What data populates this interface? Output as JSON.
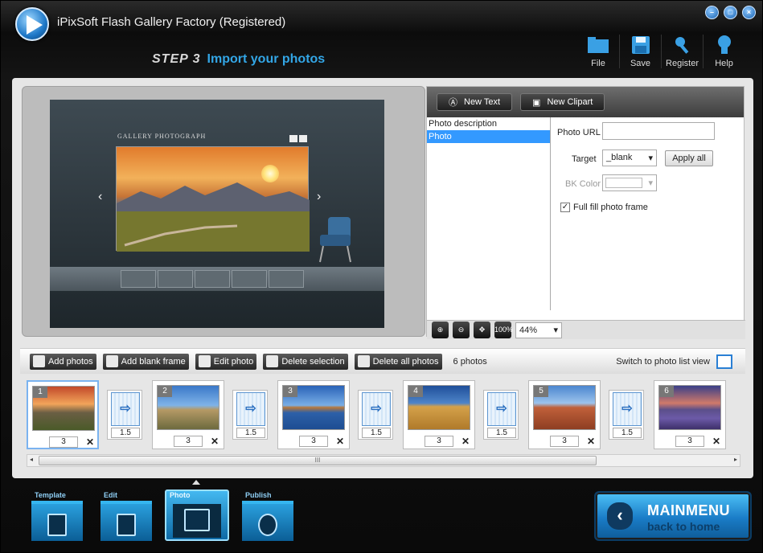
{
  "app": {
    "title": "iPixSoft Flash Gallery Factory (Registered)"
  },
  "window_controls": [
    "–",
    "□",
    "×"
  ],
  "step": {
    "number": "STEP 3",
    "text": "Import your photos"
  },
  "toolbar": [
    {
      "label": "File",
      "icon": "folder-icon"
    },
    {
      "label": "Save",
      "icon": "save-icon"
    },
    {
      "label": "Register",
      "icon": "key-icon"
    },
    {
      "label": "Help",
      "icon": "bulb-icon"
    }
  ],
  "preview": {
    "gallery_title": "GALLERY PHOTOGRAPH",
    "prev_arrow": "‹",
    "next_arrow": "›"
  },
  "side": {
    "new_text": "New Text",
    "new_clipart": "New Clipart",
    "list": [
      "Photo description",
      "Photo"
    ],
    "photo_url_label": "Photo URL",
    "photo_url_value": "",
    "target_label": "Target",
    "target_value": "_blank",
    "apply_all": "Apply all",
    "bk_color_label": "BK Color",
    "full_fill_label": "Full fill photo frame",
    "full_fill_checked": true,
    "zoom_value": "44%",
    "zoom_100": "100%"
  },
  "actions": {
    "add_photos": "Add photos",
    "add_blank_frame": "Add blank frame",
    "edit_photo": "Edit photo",
    "delete_selection": "Delete selection",
    "delete_all_photos": "Delete all photos",
    "count": "6 photos",
    "switch_view": "Switch to photo list view"
  },
  "photos": [
    {
      "num": "1",
      "duration": "3",
      "delete": "✕"
    },
    {
      "num": "2",
      "duration": "3",
      "delete": "✕"
    },
    {
      "num": "3",
      "duration": "3",
      "delete": "✕"
    },
    {
      "num": "4",
      "duration": "3",
      "delete": "✕"
    },
    {
      "num": "5",
      "duration": "3",
      "delete": "✕"
    },
    {
      "num": "6",
      "duration": "3",
      "delete": "✕"
    }
  ],
  "transitions": [
    {
      "duration": "1.5",
      "icon": "⇨"
    },
    {
      "duration": "1.5",
      "icon": "⇨"
    },
    {
      "duration": "1.5",
      "icon": "⇨"
    },
    {
      "duration": "1.5",
      "icon": "⇨"
    },
    {
      "duration": "1.5",
      "icon": "⇨"
    }
  ],
  "scrollbar": {
    "grip": "III",
    "left": "◂",
    "right": "▸"
  },
  "nav": [
    {
      "label": "Template",
      "icon": "template-icon",
      "active": false
    },
    {
      "label": "Edit",
      "icon": "edit-icon",
      "active": false
    },
    {
      "label": "Photo",
      "icon": "photo-icon",
      "active": true
    },
    {
      "label": "Publish",
      "icon": "publish-icon",
      "active": false
    }
  ],
  "mainmenu": {
    "title": "MAINMENU",
    "subtitle": "back to home",
    "arrow": "‹"
  }
}
